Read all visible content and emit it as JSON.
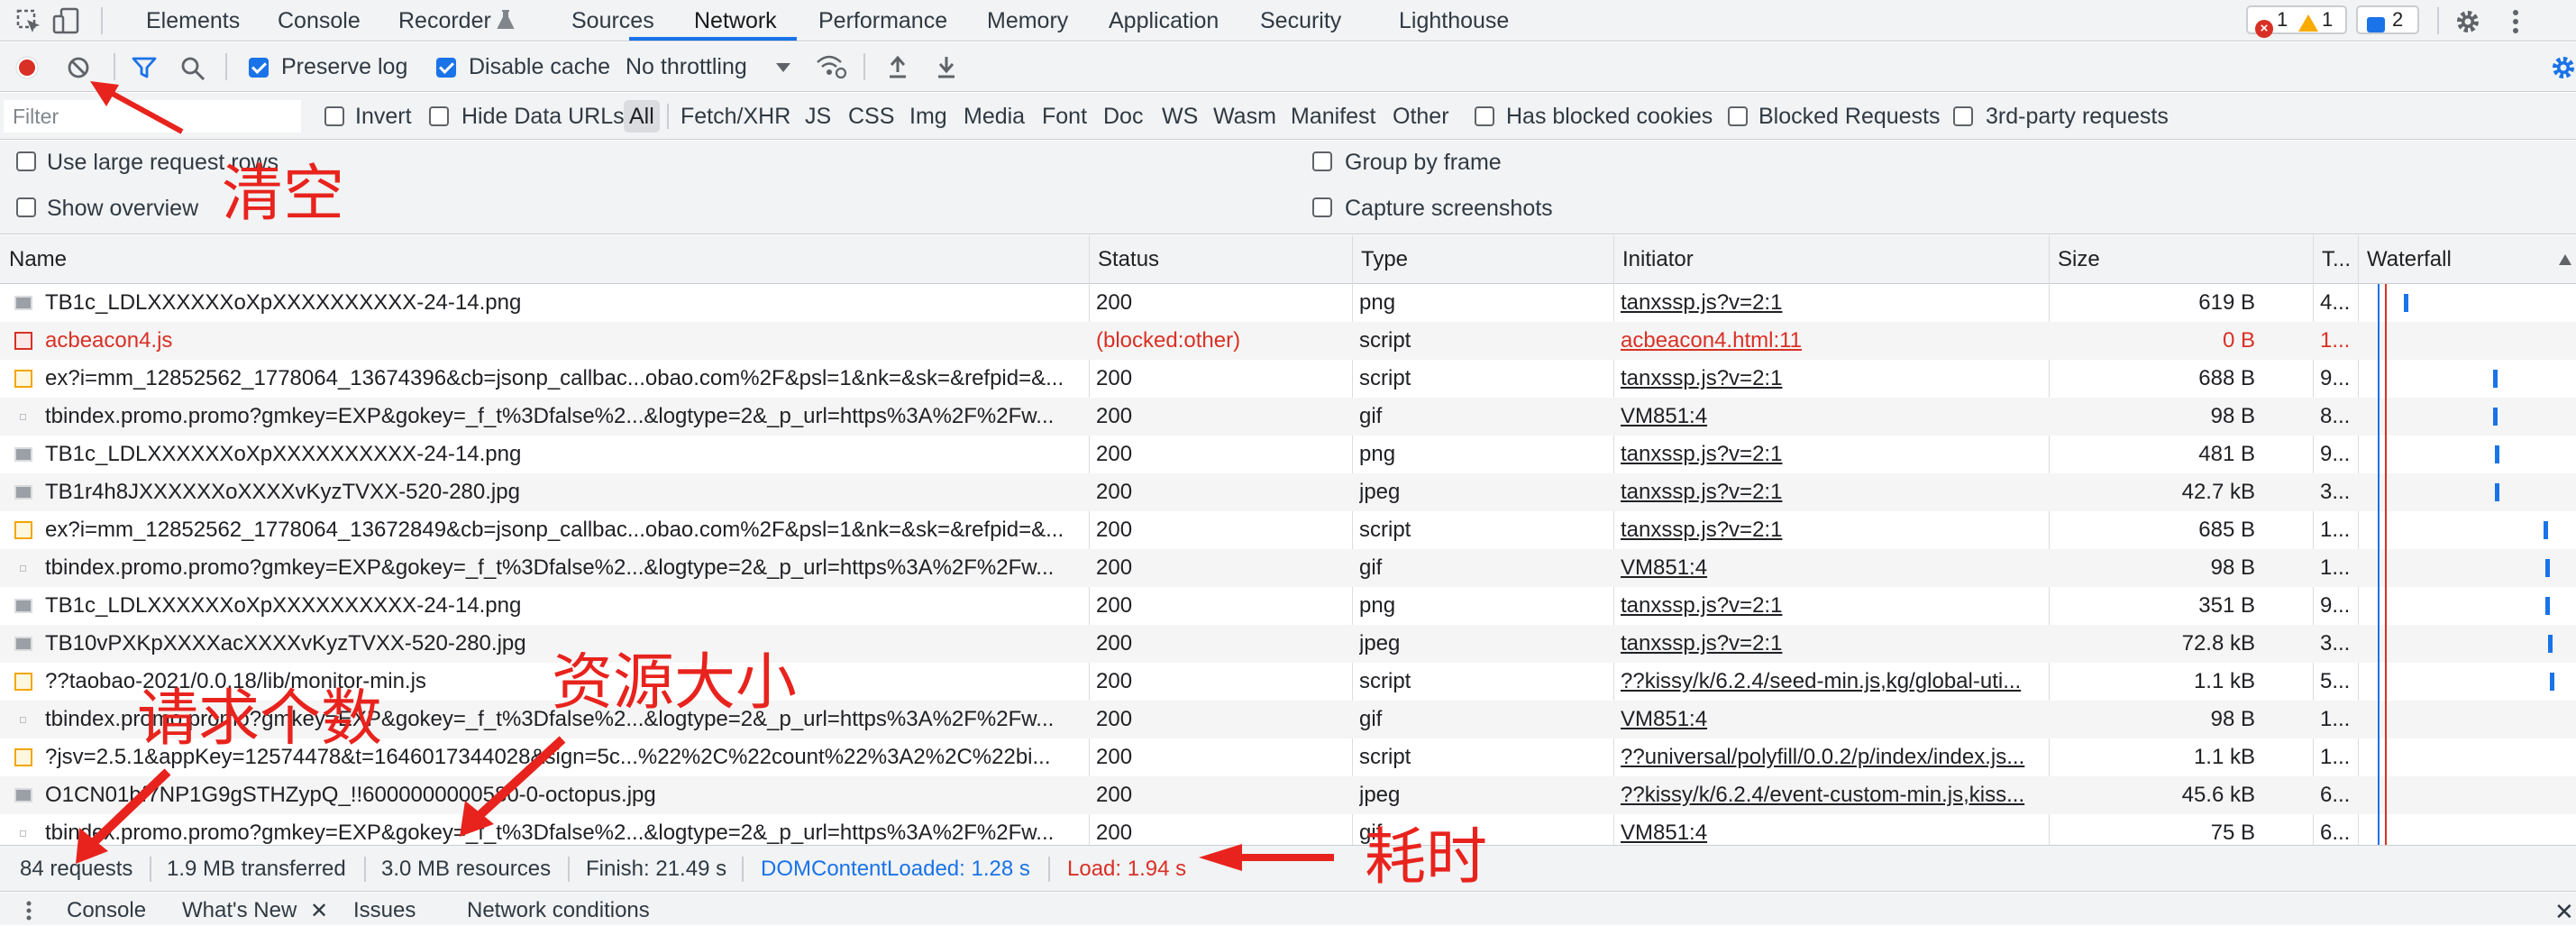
{
  "tabs": [
    "Elements",
    "Console",
    "Recorder",
    "Sources",
    "Network",
    "Performance",
    "Memory",
    "Application",
    "Security",
    "Lighthouse"
  ],
  "active_tab": "Network",
  "badges": {
    "errors": "1",
    "warnings": "1",
    "messages": "2"
  },
  "toolbar": {
    "preserve_log": "Preserve log",
    "disable_cache": "Disable cache",
    "throttling": "No throttling",
    "preserve_log_checked": true,
    "disable_cache_checked": true
  },
  "filterbar": {
    "placeholder": "Filter",
    "invert": "Invert",
    "hide_data_urls": "Hide Data URLs",
    "types": [
      "All",
      "Fetch/XHR",
      "JS",
      "CSS",
      "Img",
      "Media",
      "Font",
      "Doc",
      "WS",
      "Wasm",
      "Manifest",
      "Other"
    ],
    "has_blocked_cookies": "Has blocked cookies",
    "blocked_requests": "Blocked Requests",
    "third_party": "3rd-party requests"
  },
  "settings": {
    "large_rows": "Use large request rows",
    "show_overview": "Show overview",
    "group_by_frame": "Group by frame",
    "capture_screenshots": "Capture screenshots"
  },
  "columns": {
    "name": "Name",
    "status": "Status",
    "type": "Type",
    "initiator": "Initiator",
    "size": "Size",
    "time": "T...",
    "waterfall": "Waterfall"
  },
  "rows": [
    {
      "name": "TB1c_LDLXXXXXXoXpXXXXXXXXXX-24-14.png",
      "status": "200",
      "type": "png",
      "initiator": "tanxssp.js?v=2:1",
      "size": "619 B",
      "time": "4...",
      "kind": "img",
      "error": false,
      "wf": 0.21
    },
    {
      "name": "acbeacon4.js",
      "status": "(blocked:other)",
      "type": "script",
      "initiator": "acbeacon4.html:11",
      "size": "0 B",
      "time": "1...",
      "kind": "errscript",
      "error": true,
      "wf": null
    },
    {
      "name": "ex?i=mm_12852562_1778064_13674396&cb=jsonp_callbac...obao.com%2F&psl=1&nk=&sk=&refpid=&...",
      "status": "200",
      "type": "script",
      "initiator": "tanxssp.js?v=2:1",
      "size": "688 B",
      "time": "9...",
      "kind": "script",
      "error": false,
      "wf": 0.62
    },
    {
      "name": "tbindex.promo.promo?gmkey=EXP&gokey=_f_t%3Dfalse%2...&logtype=2&_p_url=https%3A%2F%2Fw...",
      "status": "200",
      "type": "gif",
      "initiator": "VM851:4",
      "size": "98 B",
      "time": "8...",
      "kind": "gif",
      "error": false,
      "wf": 0.62
    },
    {
      "name": "TB1c_LDLXXXXXXoXpXXXXXXXXXX-24-14.png",
      "status": "200",
      "type": "png",
      "initiator": "tanxssp.js?v=2:1",
      "size": "481 B",
      "time": "9...",
      "kind": "img",
      "error": false,
      "wf": 0.63
    },
    {
      "name": "TB1r4h8JXXXXXXoXXXXvKyzTVXX-520-280.jpg",
      "status": "200",
      "type": "jpeg",
      "initiator": "tanxssp.js?v=2:1",
      "size": "42.7 kB",
      "time": "3...",
      "kind": "img",
      "error": false,
      "wf": 0.63
    },
    {
      "name": "ex?i=mm_12852562_1778064_13672849&cb=jsonp_callbac...obao.com%2F&psl=1&nk=&sk=&refpid=&...",
      "status": "200",
      "type": "script",
      "initiator": "tanxssp.js?v=2:1",
      "size": "685 B",
      "time": "1...",
      "kind": "script",
      "error": false,
      "wf": 0.85
    },
    {
      "name": "tbindex.promo.promo?gmkey=EXP&gokey=_f_t%3Dfalse%2...&logtype=2&_p_url=https%3A%2F%2Fw...",
      "status": "200",
      "type": "gif",
      "initiator": "VM851:4",
      "size": "98 B",
      "time": "1...",
      "kind": "gif",
      "error": false,
      "wf": 0.86
    },
    {
      "name": "TB1c_LDLXXXXXXoXpXXXXXXXXXX-24-14.png",
      "status": "200",
      "type": "png",
      "initiator": "tanxssp.js?v=2:1",
      "size": "351 B",
      "time": "9...",
      "kind": "img",
      "error": false,
      "wf": 0.86
    },
    {
      "name": "TB10vPXKpXXXXacXXXXvKyzTVXX-520-280.jpg",
      "status": "200",
      "type": "jpeg",
      "initiator": "tanxssp.js?v=2:1",
      "size": "72.8 kB",
      "time": "3...",
      "kind": "img",
      "error": false,
      "wf": 0.87
    },
    {
      "name": "??taobao-2021/0.0.18/lib/monitor-min.js",
      "status": "200",
      "type": "script",
      "initiator": "??kissy/k/6.2.4/seed-min.js,kg/global-uti...",
      "size": "1.1 kB",
      "time": "5...",
      "kind": "script",
      "error": false,
      "wf": 0.88
    },
    {
      "name": "tbindex.promo.promo?gmkey=EXP&gokey=_f_t%3Dfalse%2...&logtype=2&_p_url=https%3A%2F%2Fw...",
      "status": "200",
      "type": "gif",
      "initiator": "VM851:4",
      "size": "98 B",
      "time": "1...",
      "kind": "gif",
      "error": false,
      "wf": null
    },
    {
      "name": "?jsv=2.5.1&appKey=12574478&t=1646017344028&sign=5c...%22%2C%22count%22%3A2%2C%22bi...",
      "status": "200",
      "type": "script",
      "initiator": "??universal/polyfill/0.0.2/p/index/index.js...",
      "size": "1.1 kB",
      "time": "1...",
      "kind": "script",
      "error": false,
      "wf": null
    },
    {
      "name": "O1CN01bf7NP1G9gSTHZypQ_!!6000000000580-0-octopus.jpg",
      "status": "200",
      "type": "jpeg",
      "initiator": "??kissy/k/6.2.4/event-custom-min.js,kiss...",
      "size": "45.6 kB",
      "time": "6...",
      "kind": "img",
      "error": false,
      "wf": null
    },
    {
      "name": "tbindex.promo.promo?gmkey=EXP&gokey=_f_t%3Dfalse%2...&logtype=2&_p_url=https%3A%2F%2Fw...",
      "status": "200",
      "type": "gif",
      "initiator": "VM851:4",
      "size": "75 B",
      "time": "6...",
      "kind": "gif",
      "error": false,
      "wf": null
    }
  ],
  "statusbar": {
    "requests": "84 requests",
    "transferred": "1.9 MB transferred",
    "resources": "3.0 MB resources",
    "finish": "Finish: 21.49 s",
    "dom": "DOMContentLoaded: 1.28 s",
    "load": "Load: 1.94 s"
  },
  "drawer": {
    "tabs": [
      "Console",
      "What's New",
      "Issues",
      "Network conditions"
    ]
  },
  "annotations": {
    "clear": "清空",
    "resource_size": "资源大小",
    "request_count": "请求个数",
    "time_cost": "耗时"
  },
  "colors": {
    "accent": "#1a73e8",
    "error": "#d93025",
    "annotation": "#e8231d",
    "dom_loaded": "#1a73e8",
    "load": "#d93025"
  }
}
